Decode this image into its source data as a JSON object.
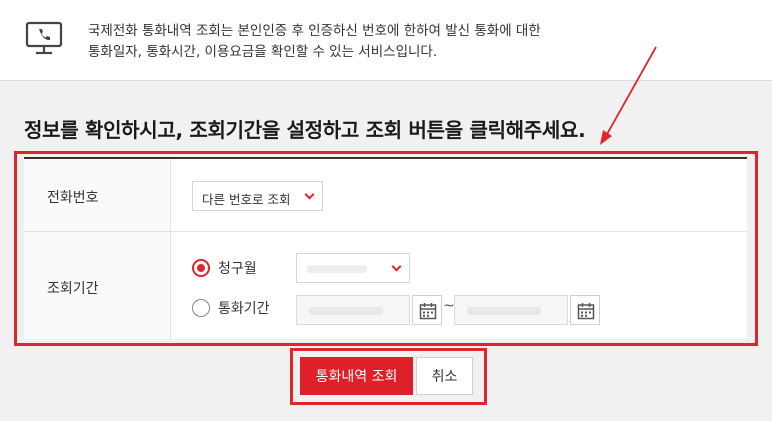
{
  "notice": {
    "icon": "monitor-phone-icon",
    "line1": "국제전화 통화내역 조회는 본인인증 후 인증하신 번호에 한하여 발신 통화에 대한",
    "line2": "통화일자, 통화시간, 이용요금을 확인할 수 있는 서비스입니다."
  },
  "instruction": "정보를 확인하시고, 조회기간을 설정하고 조회 버튼을 클릭해주세요.",
  "form": {
    "phone_label": "전화번호",
    "phone_select_value": "다른 번호로 조회",
    "period_label": "조회기간",
    "radio_billing_month": "청구월",
    "radio_call_period": "통화기간",
    "range_separator": "~"
  },
  "buttons": {
    "search": "통화내역 조회",
    "cancel": "취소"
  },
  "colors": {
    "accent": "#e0252b",
    "button_bg": "#de2128"
  }
}
